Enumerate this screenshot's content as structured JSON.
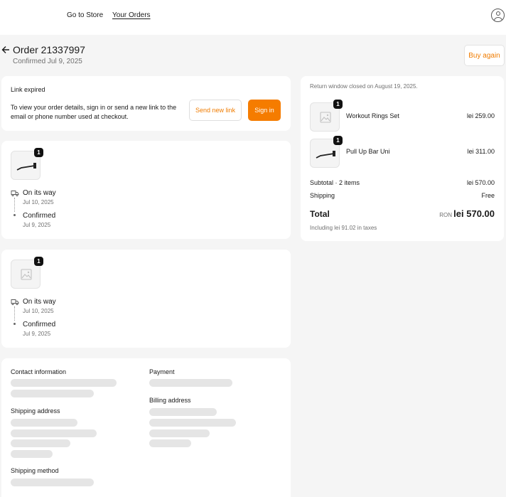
{
  "header": {
    "store_link": "Go to Store",
    "orders_link": "Your Orders"
  },
  "order": {
    "title": "Order 21337997",
    "subtitle": "Confirmed Jul 9, 2025",
    "buy_again": "Buy again"
  },
  "link_expired": {
    "title": "Link expired",
    "description": "To view your order details, sign in or send a new link to the email or phone number used at checkout.",
    "send_new_link": "Send new link",
    "sign_in": "Sign in"
  },
  "shipments": [
    {
      "quantity": "1",
      "image": "pull-up-bar-icon",
      "events": [
        {
          "status": "On its way",
          "date": "Jul 10, 2025"
        },
        {
          "status": "Confirmed",
          "date": "Jul 9, 2025"
        }
      ]
    },
    {
      "quantity": "1",
      "image": "image-placeholder-icon",
      "events": [
        {
          "status": "On its way",
          "date": "Jul 10, 2025"
        },
        {
          "status": "Confirmed",
          "date": "Jul 9, 2025"
        }
      ]
    }
  ],
  "details": {
    "contact": "Contact information",
    "payment": "Payment",
    "shipping_address": "Shipping address",
    "billing_address": "Billing address",
    "shipping_method": "Shipping method"
  },
  "summary": {
    "return_note": "Return window closed on August 19, 2025.",
    "items": [
      {
        "name": "Workout Rings Set",
        "price": "lei 259.00",
        "quantity": "1",
        "image": "image-placeholder-icon"
      },
      {
        "name": "Pull Up Bar Uni",
        "price": "lei 311.00",
        "quantity": "1",
        "image": "pull-up-bar-icon"
      }
    ],
    "subtotal_label": "Subtotal · 2 items",
    "subtotal_value": "lei 570.00",
    "shipping_label": "Shipping",
    "shipping_value": "Free",
    "total_label": "Total",
    "total_currency": "RON",
    "total_value": "lei 570.00",
    "tax_note": "Including lei 91.02 in taxes"
  },
  "colors": {
    "accent": "#f57c00",
    "background": "#f5f5f5",
    "card": "#ffffff",
    "skeleton": "#e5e5e5"
  }
}
